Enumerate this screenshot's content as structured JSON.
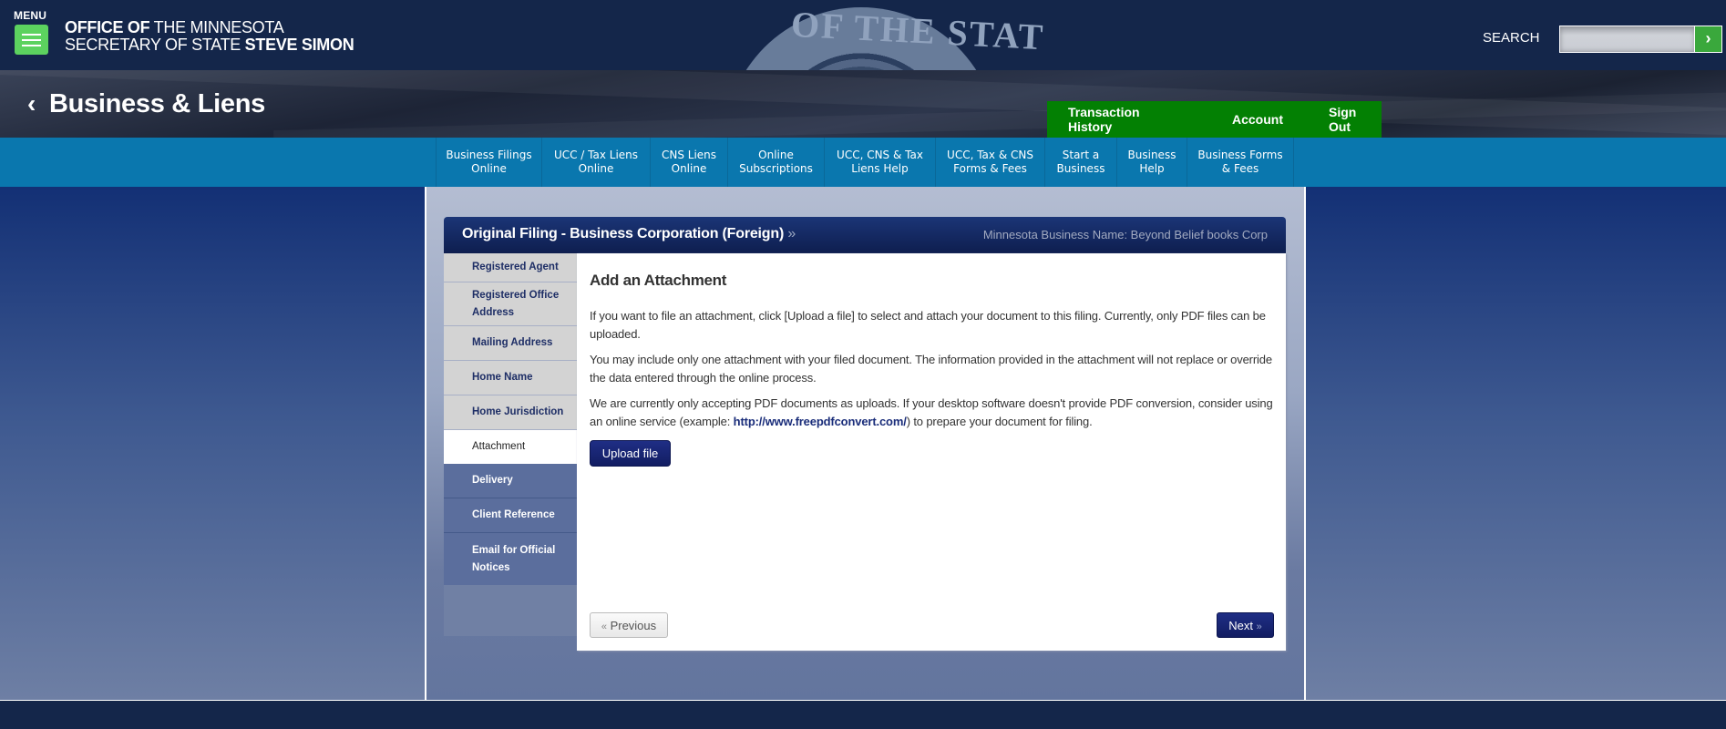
{
  "header": {
    "menu_label": "MENU",
    "office_line1_bold": "OFFICE OF",
    "office_line1_rest": " THE MINNESOTA",
    "office_line2_rest": "SECRETARY OF STATE ",
    "office_line2_bold": "STEVE SIMON",
    "seal_text": "OF THE STAT",
    "search_label": "SEARCH",
    "search_placeholder": "",
    "search_value": "",
    "search_button_icon": "›"
  },
  "banner": {
    "back_icon": "‹",
    "title": "Business & Liens",
    "account_links": [
      "Transaction History",
      "Account",
      "Sign Out"
    ]
  },
  "nav": {
    "items": [
      {
        "line1": "Business Filings",
        "line2": "Online"
      },
      {
        "line1": "UCC / Tax Liens",
        "line2": "Online"
      },
      {
        "line1": "CNS Liens",
        "line2": "Online"
      },
      {
        "line1": "Online",
        "line2": "Subscriptions"
      },
      {
        "line1": "UCC, CNS & Tax",
        "line2": "Liens Help"
      },
      {
        "line1": "UCC, Tax & CNS",
        "line2": "Forms & Fees"
      },
      {
        "line1": "Start a",
        "line2": "Business"
      },
      {
        "line1": "Business",
        "line2": "Help"
      },
      {
        "line1": "Business Forms",
        "line2": "& Fees"
      }
    ]
  },
  "card": {
    "title": "Original Filing - Business Corporation (Foreign)",
    "title_suffix": "»",
    "business_name": "Minnesota Business Name: Beyond Belief books Corp"
  },
  "sidebar": {
    "items": [
      {
        "line1": "Registered Agent",
        "line2": "",
        "state": "completed"
      },
      {
        "line1": "Registered Office",
        "line2": "Address",
        "state": "completed"
      },
      {
        "line1": "Mailing Address",
        "line2": "",
        "state": "completed"
      },
      {
        "line1": "Home Name",
        "line2": "",
        "state": "completed"
      },
      {
        "line1": "Home Jurisdiction",
        "line2": "",
        "state": "completed"
      },
      {
        "line1": "Attachment",
        "line2": "",
        "state": "current"
      },
      {
        "line1": "Delivery",
        "line2": "",
        "state": "upcoming"
      },
      {
        "line1": "Client Reference",
        "line2": "",
        "state": "upcoming"
      },
      {
        "line1": "Email for Official",
        "line2": "Notices",
        "state": "upcoming"
      }
    ]
  },
  "content": {
    "heading": "Add an Attachment",
    "para1": "If you want to file an attachment, click [Upload a file] to select and attach your document to this filing. Currently, only PDF files can be uploaded.",
    "para2": "You may include only one attachment with your filed document. The information provided in the attachment will not replace or override the data entered through the online process.",
    "para3_before": "We are currently only accepting PDF documents as uploads. If your desktop software doesn't provide PDF conversion, consider using an online service (example: ",
    "para3_link": "http://www.freepdfconvert.com/",
    "para3_after": ") to prepare your document for filing.",
    "upload_button": "Upload file",
    "prev_quote": "«",
    "prev_button": " Previous",
    "next_button": "Next ",
    "next_quote": "»"
  },
  "colors": {
    "header_bg": "#14264a",
    "menu_green": "#5cd25f",
    "account_green": "#038003",
    "nav_blue": "#0a77ae",
    "card_header_navy": "#0e1e4f",
    "button_navy": "#1f2e85",
    "link_navy": "#1a2d7a"
  }
}
